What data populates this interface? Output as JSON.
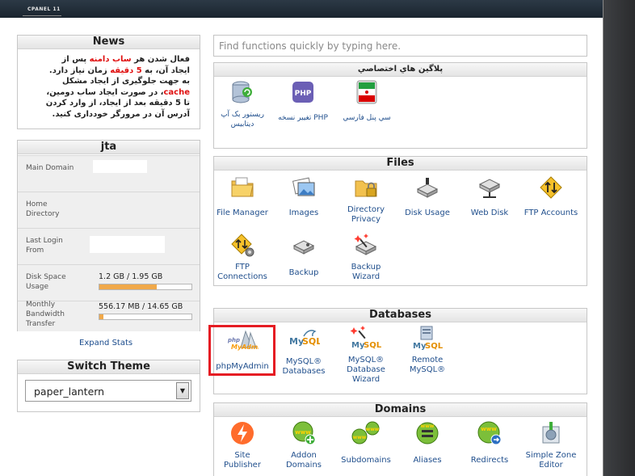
{
  "header": {
    "brand": "CPANEL 11"
  },
  "news": {
    "title": "News",
    "line1_a": "فعال شدن هر ",
    "line1_red": "ساب دامنه",
    "line1_b": " پس از",
    "line2_a": "ایجاد آن، به ",
    "line2_red": "5 دقیقه",
    "line2_b": " زمان نیاز دارد.",
    "line3": "به جهت جلوگیری از ایجاد مشکل",
    "line4_red": "cache",
    "line4_b": "، در صورت ایجاد ساب دومین،",
    "line5": "تا 5 دقیقه بعد از ایجاد، از وارد کردن",
    "line6": "آدرس آن در مرورگر خودداری کنید."
  },
  "stats": {
    "title": "jta",
    "main_domain_label": "Main Domain",
    "home_dir_label": "Home Directory",
    "last_login_label": "Last Login From",
    "disk_label": "Disk Space Usage",
    "disk_value": "1.2 GB / 1.95 GB",
    "disk_fill": 0.62,
    "bandwidth_label": "Monthly Bandwidth Transfer",
    "bandwidth_value": "556.17 MB / 14.65 GB",
    "bandwidth_fill": 0.04,
    "expand": "Expand Stats"
  },
  "theme": {
    "title": "Switch Theme",
    "selected": "paper_lantern"
  },
  "search": {
    "placeholder": "Find functions quickly by typing here."
  },
  "plugins": {
    "title": "پلاگین هاي اختصاصي",
    "items": [
      {
        "label": "سي پنل فارسي",
        "icon": "iran-flag-icon"
      },
      {
        "label": "PHP تغییر نسخه",
        "icon": "php-icon"
      },
      {
        "label": "ریستور بک آپ دیتابیس",
        "icon": "database-restore-icon"
      }
    ]
  },
  "files": {
    "title": "Files",
    "items": [
      {
        "label": "File Manager",
        "icon": "folder-icon"
      },
      {
        "label": "Images",
        "icon": "images-icon"
      },
      {
        "label": "Directory Privacy",
        "icon": "lock-folder-icon"
      },
      {
        "label": "Disk Usage",
        "icon": "disk-icon"
      },
      {
        "label": "Web Disk",
        "icon": "web-disk-icon"
      },
      {
        "label": "FTP Accounts",
        "icon": "ftp-accounts-icon"
      },
      {
        "label": "FTP Connections",
        "icon": "ftp-connections-icon"
      },
      {
        "label": "Backup",
        "icon": "backup-icon"
      },
      {
        "label": "Backup Wizard",
        "icon": "backup-wizard-icon"
      }
    ]
  },
  "databases": {
    "title": "Databases",
    "items": [
      {
        "label": "phpMyAdmin",
        "icon": "phpmyadmin-icon"
      },
      {
        "label": "MySQL® Databases",
        "icon": "mysql-icon"
      },
      {
        "label": "MySQL® Database Wizard",
        "icon": "mysql-wizard-icon"
      },
      {
        "label": "Remote MySQL®",
        "icon": "remote-mysql-icon"
      }
    ]
  },
  "domains": {
    "title": "Domains",
    "items": [
      {
        "label": "Site Publisher",
        "icon": "site-publisher-icon"
      },
      {
        "label": "Addon Domains",
        "icon": "addon-domains-icon"
      },
      {
        "label": "Subdomains",
        "icon": "subdomains-icon"
      },
      {
        "label": "Aliases",
        "icon": "aliases-icon"
      },
      {
        "label": "Redirects",
        "icon": "redirects-icon"
      },
      {
        "label": "Simple Zone Editor",
        "icon": "zone-editor-icon"
      }
    ]
  }
}
